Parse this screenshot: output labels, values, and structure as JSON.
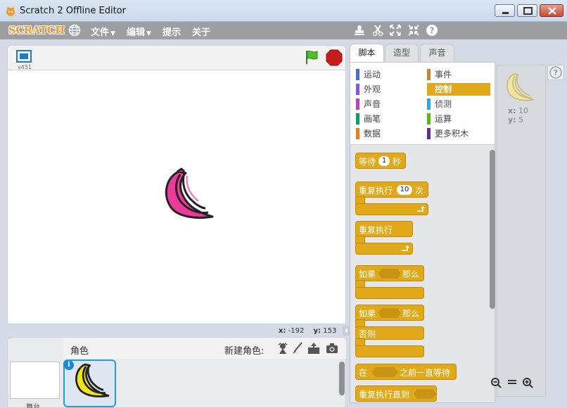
{
  "window": {
    "title": "Scratch 2 Offline Editor"
  },
  "menubar": {
    "logo": "SCRATCH",
    "items": [
      {
        "label": "文件",
        "caret": "▼"
      },
      {
        "label": "编辑",
        "caret": "▼"
      },
      {
        "label": "提示"
      },
      {
        "label": "关于"
      }
    ],
    "tool_icons": [
      "stamp-icon",
      "scissors-icon",
      "grow-icon",
      "shrink-icon",
      "help-icon"
    ]
  },
  "stage": {
    "version": "v451",
    "coords": {
      "x_label": "x:",
      "x": "-192",
      "y_label": "y:",
      "y": "153"
    }
  },
  "sprites_panel": {
    "label": "角色",
    "new_sprite_label": "新建角色:",
    "stage_thumb_label": "舞台",
    "new_sprite_icons": [
      "paint-new-sprite-icon",
      "brush-icon",
      "upload-icon",
      "camera-icon"
    ]
  },
  "tabs": [
    {
      "label": "脚本",
      "active": true
    },
    {
      "label": "造型",
      "active": false
    },
    {
      "label": "声音",
      "active": false
    }
  ],
  "categories": [
    {
      "label": "运动",
      "color": "#4a6cd4"
    },
    {
      "label": "事件",
      "color": "#c88330"
    },
    {
      "label": "外观",
      "color": "#8a55d7"
    },
    {
      "label": "控制",
      "color": "#e1a91a",
      "selected": true
    },
    {
      "label": "声音",
      "color": "#bb42c3"
    },
    {
      "label": "侦测",
      "color": "#2ca5e2"
    },
    {
      "label": "画笔",
      "color": "#0e9a6c"
    },
    {
      "label": "运算",
      "color": "#5cb712"
    },
    {
      "label": "数据",
      "color": "#ee7d16"
    },
    {
      "label": "更多积木",
      "color": "#632d99"
    }
  ],
  "blocks": {
    "wait": {
      "pre": "等待",
      "value": "1",
      "post": "秒"
    },
    "repeat": {
      "pre": "重复执行",
      "value": "10",
      "post": "次"
    },
    "forever": {
      "label": "重复执行"
    },
    "if_then": {
      "pre": "如果",
      "post": "那么"
    },
    "if_else": {
      "pre": "如果",
      "post": "那么",
      "else": "否则"
    },
    "wait_until": {
      "pre": "在",
      "post": "之前一直等待"
    },
    "repeat_until": {
      "label": "重复执行直到"
    }
  },
  "sprite_info": {
    "x_label": "x:",
    "x": "10",
    "y_label": "y:",
    "y": "5"
  },
  "colors": {
    "control": "#e1a91a",
    "stage_sprite": "#ec3b9a",
    "thumb_sprite": "#f2e31a",
    "info_sprite": "#efe4a4"
  }
}
